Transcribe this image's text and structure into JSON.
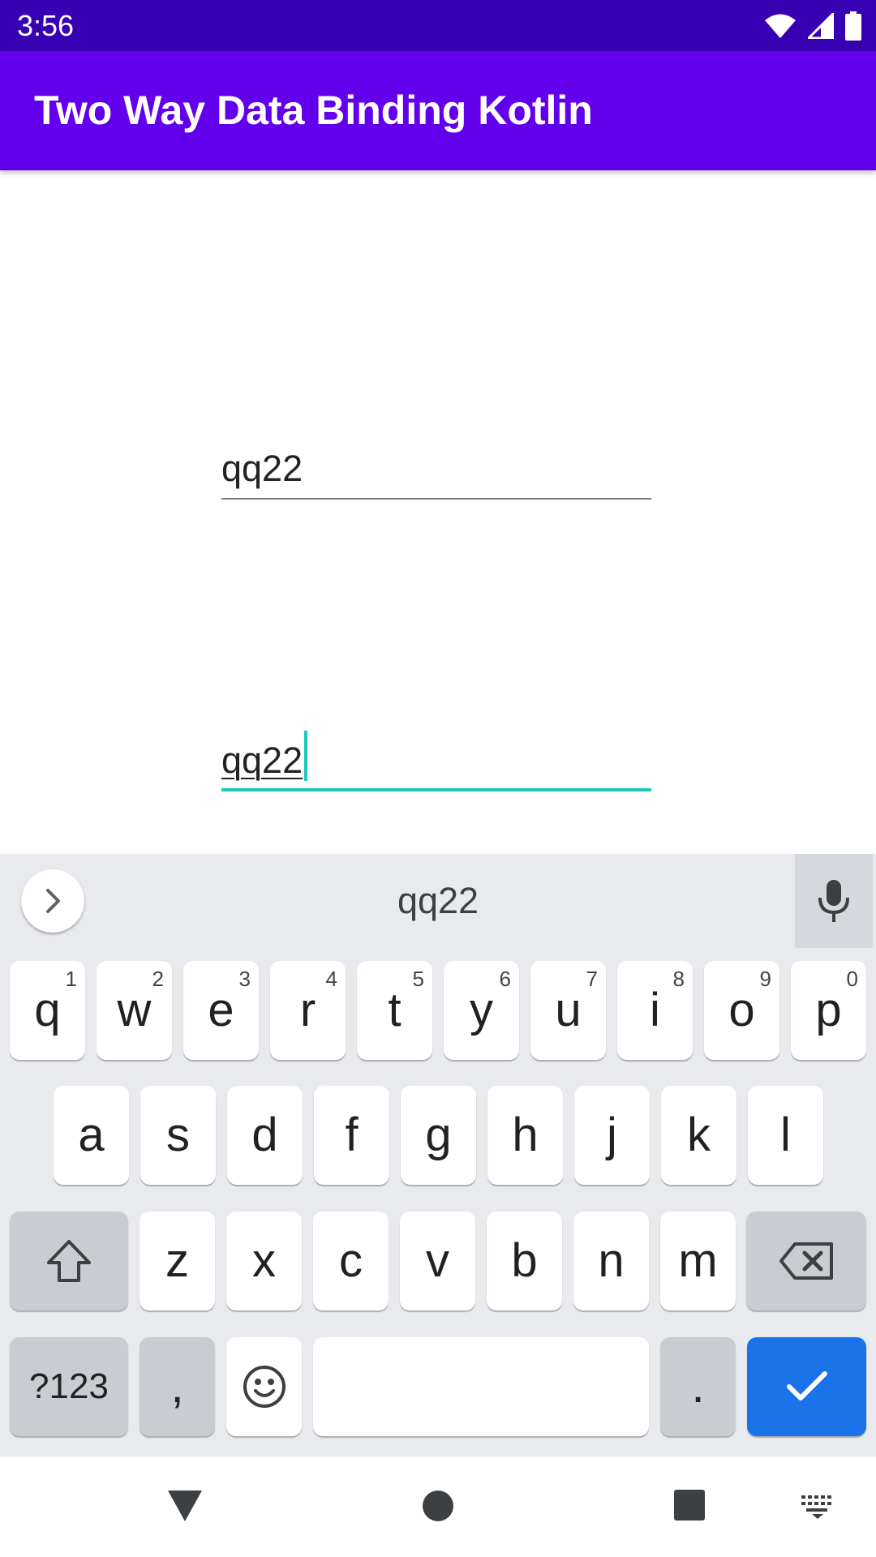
{
  "status_bar": {
    "time": "3:56",
    "icons": [
      "wifi-icon",
      "cell-signal-icon",
      "battery-icon"
    ],
    "color": "#3700b3"
  },
  "app_bar": {
    "title": "Two Way Data Binding Kotlin",
    "color": "#6200ee"
  },
  "fields": [
    {
      "value": "qq22",
      "focused": false
    },
    {
      "value": "qq22",
      "focused": true,
      "accent": "#1cc9bd"
    }
  ],
  "keyboard": {
    "suggestion": "qq22",
    "row1": [
      {
        "label": "q",
        "hint": "1"
      },
      {
        "label": "w",
        "hint": "2"
      },
      {
        "label": "e",
        "hint": "3"
      },
      {
        "label": "r",
        "hint": "4"
      },
      {
        "label": "t",
        "hint": "5"
      },
      {
        "label": "y",
        "hint": "6"
      },
      {
        "label": "u",
        "hint": "7"
      },
      {
        "label": "i",
        "hint": "8"
      },
      {
        "label": "o",
        "hint": "9"
      },
      {
        "label": "p",
        "hint": "0"
      }
    ],
    "row2": [
      "a",
      "s",
      "d",
      "f",
      "g",
      "h",
      "j",
      "k",
      "l"
    ],
    "row3": [
      "z",
      "x",
      "c",
      "v",
      "b",
      "n",
      "m"
    ],
    "symbols_label": "?123",
    "comma_label": ",",
    "period_label": ".",
    "enter_color": "#1a73e8"
  },
  "nav_bar": {
    "icons": [
      "back-icon",
      "home-icon",
      "recents-icon",
      "keyboard-switch-icon"
    ]
  }
}
